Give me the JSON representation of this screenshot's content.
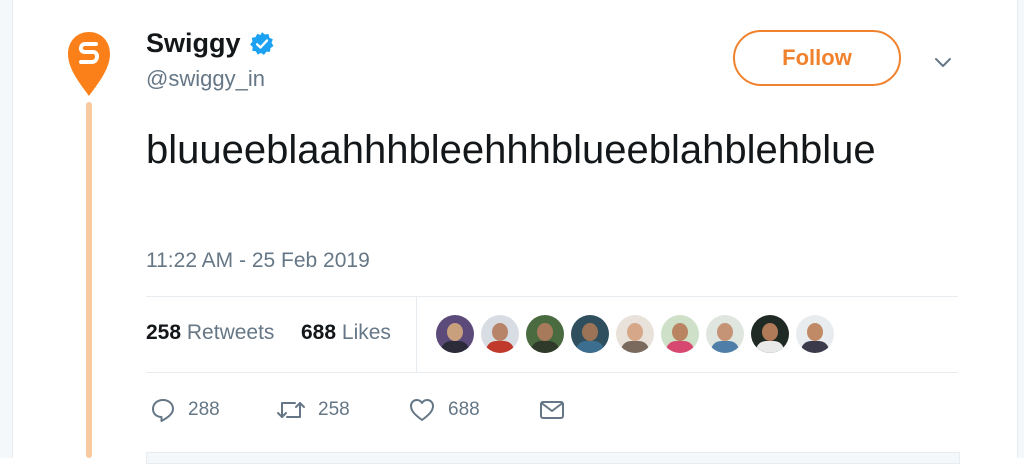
{
  "account": {
    "name": "Swiggy",
    "handle": "@swiggy_in",
    "brand_color": "#fc8019",
    "verified_color": "#1da1f2"
  },
  "follow_button": {
    "label": "Follow",
    "color": "#f0822e"
  },
  "tweet": {
    "text": "bluueeblaahhhbleehhhblueeblahblehblue",
    "timestamp": "11:22 AM - 25 Feb 2019"
  },
  "stats": {
    "retweets_count": "258",
    "retweets_label": "Retweets",
    "likes_count": "688",
    "likes_label": "Likes"
  },
  "liker_avatars": [
    {
      "bg": "#5b4a7a",
      "face": "#c9a07e",
      "body": "#2b2b3a"
    },
    {
      "bg": "#d8dde4",
      "face": "#b88469",
      "body": "#c0392b"
    },
    {
      "bg": "#4a6b3f",
      "face": "#a87a5c",
      "body": "#2f3a2a"
    },
    {
      "bg": "#2f4f5e",
      "face": "#9c7356",
      "body": "#3c6e8f"
    },
    {
      "bg": "#e8e2da",
      "face": "#d6a889",
      "body": "#7a6a5e"
    },
    {
      "bg": "#cfe0c8",
      "face": "#b98462",
      "body": "#d6486f"
    },
    {
      "bg": "#dfe6e0",
      "face": "#c59476",
      "body": "#4f7fa8"
    },
    {
      "bg": "#1f2a24",
      "face": "#b07a58",
      "body": "#e9e9e9"
    },
    {
      "bg": "#e9ecef",
      "face": "#c08a66",
      "body": "#3a3a4a"
    }
  ],
  "actions": {
    "reply_icon": "reply-icon",
    "reply_count": "288",
    "retweet_icon": "retweet-icon",
    "retweet_count": "258",
    "like_icon": "heart-icon",
    "like_count": "688",
    "dm_icon": "envelope-icon"
  }
}
